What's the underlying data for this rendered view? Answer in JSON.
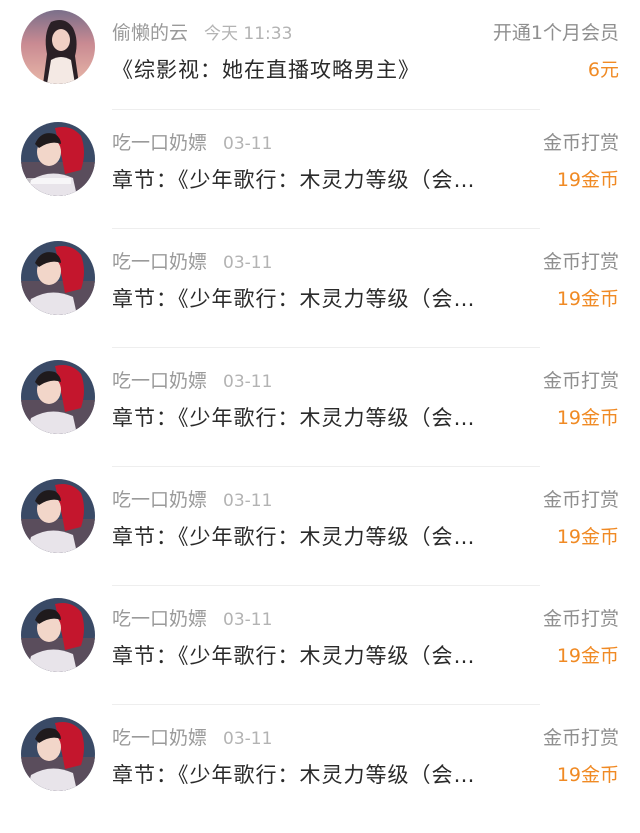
{
  "colors": {
    "accent_orange": "#f08a24",
    "secondary_text": "#9a9a9a",
    "primary_text": "#2a2a2a",
    "divider": "#eeeeee"
  },
  "records": [
    {
      "avatar_icon": "user-avatar-girl-sunset",
      "name": "偷懒的云",
      "time": "今天 11:33",
      "title": "《综影视：她在直播攻略男主》",
      "action": "开通1个月会员",
      "amount": "6元"
    },
    {
      "avatar_icon": "user-avatar-boy-red-hat",
      "name": "吃一口奶嫖",
      "time": "03-11",
      "title": "章节：《少年歌行：木灵力等级（会…",
      "action": "金币打赏",
      "amount": "19金币"
    },
    {
      "avatar_icon": "user-avatar-boy-red-hat",
      "name": "吃一口奶嫖",
      "time": "03-11",
      "title": "章节：《少年歌行：木灵力等级（会…",
      "action": "金币打赏",
      "amount": "19金币"
    },
    {
      "avatar_icon": "user-avatar-boy-red-hat",
      "name": "吃一口奶嫖",
      "time": "03-11",
      "title": "章节：《少年歌行：木灵力等级（会…",
      "action": "金币打赏",
      "amount": "19金币"
    },
    {
      "avatar_icon": "user-avatar-boy-red-hat",
      "name": "吃一口奶嫖",
      "time": "03-11",
      "title": "章节：《少年歌行：木灵力等级（会…",
      "action": "金币打赏",
      "amount": "19金币"
    },
    {
      "avatar_icon": "user-avatar-boy-red-hat",
      "name": "吃一口奶嫖",
      "time": "03-11",
      "title": "章节：《少年歌行：木灵力等级（会…",
      "action": "金币打赏",
      "amount": "19金币"
    },
    {
      "avatar_icon": "user-avatar-boy-red-hat",
      "name": "吃一口奶嫖",
      "time": "03-11",
      "title": "章节：《少年歌行：木灵力等级（会…",
      "action": "金币打赏",
      "amount": "19金币"
    }
  ]
}
